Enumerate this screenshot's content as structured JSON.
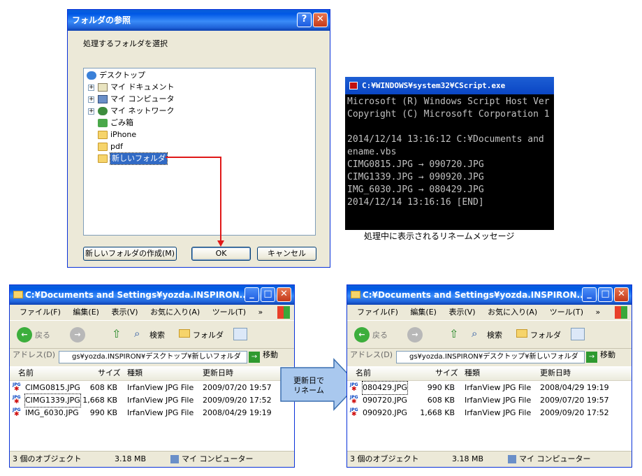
{
  "dialog": {
    "title": "フォルダの参照",
    "help_label": "?",
    "close_label": "✕",
    "prompt": "処理するフォルダを選択",
    "tree": [
      {
        "label": "デスクトップ",
        "level": 0,
        "icon": "desktop-icon",
        "expander": ""
      },
      {
        "label": "マイ ドキュメント",
        "level": 1,
        "icon": "my-documents-icon",
        "expander": "+"
      },
      {
        "label": "マイ コンピュータ",
        "level": 1,
        "icon": "my-computer-icon",
        "expander": "+"
      },
      {
        "label": "マイ ネットワーク",
        "level": 1,
        "icon": "my-network-icon",
        "expander": "+"
      },
      {
        "label": "ごみ箱",
        "level": 1,
        "icon": "recycle-bin-icon",
        "expander": ""
      },
      {
        "label": "iPhone",
        "level": 1,
        "icon": "folder-icon",
        "expander": ""
      },
      {
        "label": "pdf",
        "level": 1,
        "icon": "folder-icon",
        "expander": ""
      },
      {
        "label": "新しいフォルダ",
        "level": 1,
        "icon": "folder-icon",
        "expander": "",
        "selected": true
      }
    ],
    "new_folder_button": "新しいフォルダの作成(M)",
    "ok_button": "OK",
    "cancel_button": "キャンセル"
  },
  "console": {
    "title": "C:¥WINDOWS¥system32¥CScript.exe",
    "lines": [
      "Microsoft (R) Windows Script Host Ver",
      "Copyright (C) Microsoft Corporation 1",
      "",
      "2014/12/14 13:16:12 C:¥Documents and",
      "ename.vbs",
      "CIMG0815.JPG → 090720.JPG",
      "CIMG1339.JPG → 090920.JPG",
      "IMG_6030.JPG → 080429.JPG",
      "2014/12/14 13:16:16 [END]"
    ],
    "caption": "処理中に表示されるリネームメッセージ"
  },
  "arrow_label": [
    "更新日で",
    "リネーム"
  ],
  "explorer_common": {
    "title": "C:¥Documents and Settings¥yozda.INSPIRON...",
    "menu": [
      "ファイル(F)",
      "編集(E)",
      "表示(V)",
      "お気に入り(A)",
      "ツール(T)"
    ],
    "menu_more": "»",
    "back_label": "戻る",
    "search_label": "検索",
    "folders_label": "フォルダ",
    "address_label": "アドレス(D)",
    "address_value": "gs¥yozda.INSPIRON¥デスクトップ¥新しいフォルダ",
    "go_label": "移動",
    "columns": [
      "名前",
      "サイズ",
      "種類",
      "更新日時"
    ],
    "status_count": "3 個のオブジェクト",
    "status_size": "3.18 MB",
    "status_location": "マイ コンピューター"
  },
  "explorer_left": {
    "files": [
      {
        "name": "CIMG0815.JPG",
        "size": "608 KB",
        "type": "IrfanView JPG File",
        "date": "2009/07/20 19:57"
      },
      {
        "name": "CIMG1339.JPG",
        "size": "1,668 KB",
        "type": "IrfanView JPG File",
        "date": "2009/09/20 17:52"
      },
      {
        "name": "IMG_6030.JPG",
        "size": "990 KB",
        "type": "IrfanView JPG File",
        "date": "2008/04/29 19:19"
      }
    ]
  },
  "explorer_right": {
    "files": [
      {
        "name": "080429.JPG",
        "size": "990 KB",
        "type": "IrfanView JPG File",
        "date": "2008/04/29 19:19"
      },
      {
        "name": "090720.JPG",
        "size": "608 KB",
        "type": "IrfanView JPG File",
        "date": "2009/07/20 19:57"
      },
      {
        "name": "090920.JPG",
        "size": "1,668 KB",
        "type": "IrfanView JPG File",
        "date": "2009/09/20 17:52"
      }
    ]
  },
  "colors": {
    "xp_blue": "#0058e6",
    "dialog_bg": "#ece9d8",
    "selection": "#316ac5",
    "connector_red": "#e01818"
  }
}
